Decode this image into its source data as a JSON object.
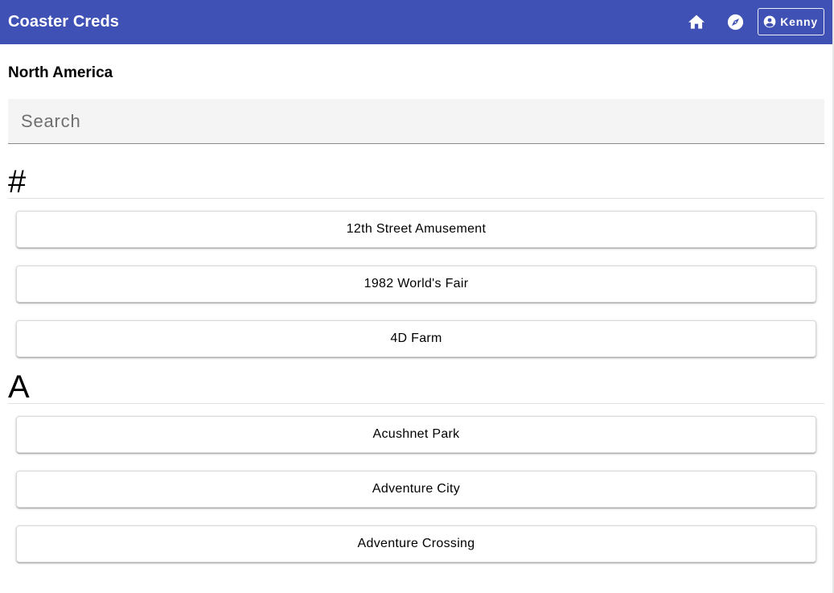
{
  "header": {
    "app_title": "Coaster Creds",
    "home_icon": "home-icon",
    "explore_icon": "compass-icon",
    "user": {
      "icon": "account-circle-icon",
      "label": "Kenny"
    },
    "colors": {
      "bar": "#3f51b5",
      "text": "#ffffff"
    }
  },
  "main": {
    "region_title": "North America",
    "search": {
      "placeholder": "Search",
      "value": ""
    },
    "sections": [
      {
        "letter": "#",
        "parks": [
          "12th Street Amusement",
          "1982 World's Fair",
          "4D Farm"
        ]
      },
      {
        "letter": "A",
        "parks": [
          "Acushnet Park",
          "Adventure City",
          "Adventure Crossing"
        ]
      }
    ]
  }
}
